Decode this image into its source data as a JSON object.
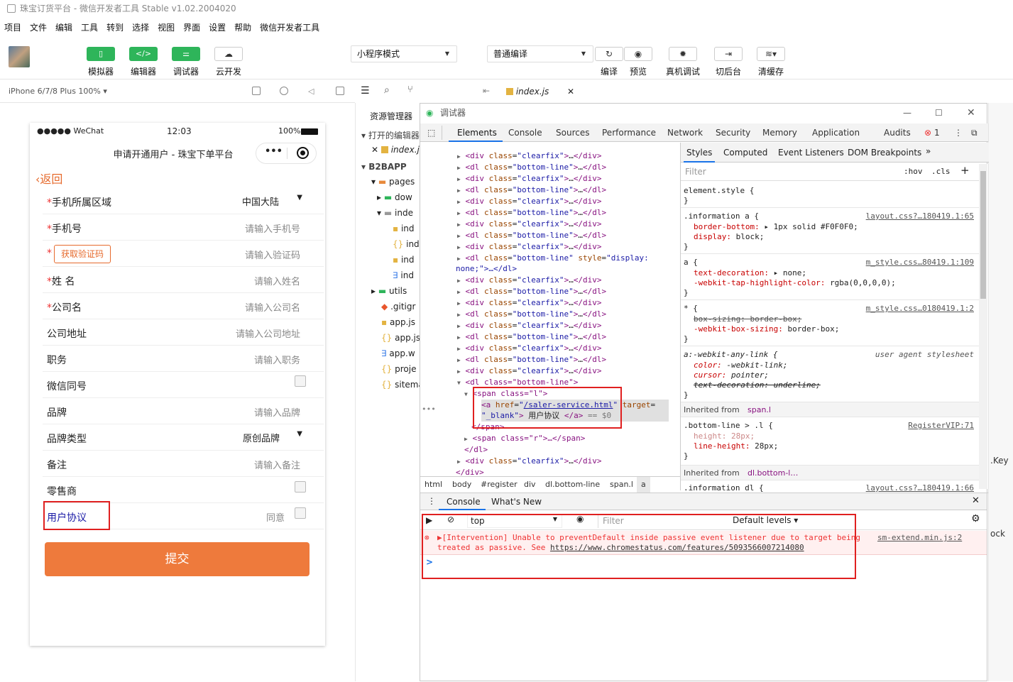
{
  "window": {
    "title": "珠宝订货平台 - 微信开发者工具 Stable v1.02.2004020"
  },
  "menu": [
    "项目",
    "文件",
    "编辑",
    "工具",
    "转到",
    "选择",
    "视图",
    "界面",
    "设置",
    "帮助",
    "微信开发者工具"
  ],
  "toolbar": {
    "simulator": "模拟器",
    "editor": "编辑器",
    "debugger": "调试器",
    "cloud": "云开发",
    "mode": "小程序模式",
    "compile_mode": "普通编译",
    "compile": "编译",
    "preview": "预览",
    "real_debug": "真机调试",
    "background": "切后台",
    "clear_cache": "清缓存"
  },
  "simulator": {
    "device": "iPhone 6/7/8 Plus 100% ▾"
  },
  "phone": {
    "carrier": "●●●●● WeChat",
    "time": "12:03",
    "battery": "100%",
    "nav_title": "申请开通用户 - 珠宝下单平台",
    "back": "返回",
    "rows": [
      {
        "star": "*",
        "label": "手机所属区域",
        "value": "中国大陆"
      },
      {
        "star": "*",
        "label": "手机号",
        "placeholder": "请输入手机号"
      },
      {
        "star": "*",
        "button": "获取验证码",
        "placeholder": "请输入验证码"
      },
      {
        "star": "*",
        "label": "姓 名",
        "placeholder": "请输入姓名"
      },
      {
        "star": "*",
        "label": "公司名",
        "placeholder": "请输入公司名"
      },
      {
        "label": "公司地址",
        "placeholder": "请输入公司地址"
      },
      {
        "label": "职务",
        "placeholder": "请输入职务"
      },
      {
        "label": "微信同号"
      },
      {
        "label": "品牌",
        "placeholder": "请输入品牌"
      },
      {
        "label": "品牌类型",
        "value": "原创品牌"
      },
      {
        "label": "备注",
        "placeholder": "请输入备注"
      },
      {
        "label": "零售商"
      },
      {
        "label": "用户协议",
        "agree": "同意"
      }
    ],
    "submit": "提交"
  },
  "filetree": {
    "resource_manager": "资源管理器",
    "open_editors": "打开的编辑器",
    "open_file": "index.j",
    "project": "B2BAPP",
    "items": [
      "pages",
      "dow",
      "inde",
      "ind",
      "ind",
      "ind",
      "ind",
      "utils",
      ".gitigr",
      "app.js",
      "app.js",
      "app.w",
      "proje",
      "sitema"
    ]
  },
  "editor_tab": {
    "name": "index.js"
  },
  "devtools": {
    "title": "调试器",
    "tabs": [
      "Elements",
      "Console",
      "Sources",
      "Performance",
      "Network",
      "Security",
      "Memory",
      "Application",
      "Audits"
    ],
    "error_count": "1",
    "elements": [
      {
        "t": "div",
        "c": "clearfix"
      },
      {
        "t": "dl",
        "c": "bottom-line"
      },
      {
        "t": "div",
        "c": "clearfix"
      },
      {
        "t": "dl",
        "c": "bottom-line"
      },
      {
        "t": "div",
        "c": "clearfix"
      },
      {
        "t": "dl",
        "c": "bottom-line"
      },
      {
        "t": "div",
        "c": "clearfix"
      },
      {
        "t": "dl",
        "c": "bottom-line"
      },
      {
        "t": "div",
        "c": "clearfix"
      }
    ],
    "elements_tail": [
      {
        "t": "div",
        "c": "clearfix"
      },
      {
        "t": "dl",
        "c": "bottom-line"
      },
      {
        "t": "div",
        "c": "clearfix"
      },
      {
        "t": "dl",
        "c": "bottom-line"
      },
      {
        "t": "div",
        "c": "clearfix"
      },
      {
        "t": "dl",
        "c": "bottom-line"
      },
      {
        "t": "div",
        "c": "clearfix"
      },
      {
        "t": "dl",
        "c": "bottom-line"
      },
      {
        "t": "div",
        "c": "clearfix"
      }
    ],
    "style_none": "none;\">…</dl>",
    "open_dl": "<dl class=\"bottom-line\">",
    "span_open": "<span class=\"l\">",
    "a_href": "/saler-service.html",
    "a_target": "_blank",
    "a_text": "用户协议",
    "a_end": "== $0",
    "span_close": "</span>",
    "span_r": "<span class=\"r\">…</span>",
    "dl_close": "</dl>",
    "div_close": "</div>",
    "styles_tabs": [
      "Styles",
      "Computed",
      "Event Listeners",
      "DOM Breakpoints"
    ],
    "filter": "Filter",
    "hov": ":hov",
    "cls": ".cls",
    "breadcrumb": [
      "html",
      "body",
      "#register",
      "div",
      "dl.bottom-line",
      "span.l",
      "a"
    ],
    "style_rules": {
      "element_style": "element.style {",
      "info_a_sel": ".information a {",
      "info_a_src": "layout.css?…180419.1:65",
      "info_a_p1": "border-bottom:",
      "info_a_v1": "1px solid  #F0F0F0;",
      "info_a_p2": "display:",
      "info_a_v2": "block;",
      "a_sel": "a {",
      "a_src": "m_style.css…80419.1:109",
      "a_p1": "text-decoration:",
      "a_v1": "none;",
      "a_p2": "-webkit-tap-highlight-color:",
      "a_v2": "rgba(0,0,0,0);",
      "star_sel": "* {",
      "star_src": "m_style.css…0180419.1:2",
      "star_p1": "box-sizing: border-box;",
      "star_p2": "-webkit-box-sizing:",
      "star_v2": "border-box;",
      "ua_sel": "a:-webkit-any-link {",
      "ua_src": "user agent stylesheet",
      "ua_p1": "color:",
      "ua_v1": "-webkit-link;",
      "ua_p2": "cursor:",
      "ua_v2": "pointer;",
      "ua_p3": "text-decoration: underline;",
      "inh1": "Inherited from",
      "inh1_v": "span.l",
      "bl_sel": ".bottom-line > .l {",
      "bl_src": "RegisterVIP:71",
      "bl_p1": "height: 28px;",
      "bl_p2": "line-height:",
      "bl_v2": "28px;",
      "inh2": "Inherited from",
      "inh2_v": "dl.bottom-l…",
      "last_sel": ".information dl {",
      "last_src": "layout.css?…180419.1:66"
    },
    "console": {
      "tabs": [
        "Console",
        "What's New"
      ],
      "context": "top",
      "filter": "Filter",
      "levels": "Default levels ▾",
      "message": "▶[Intervention] Unable to preventDefault inside passive event listener due to target being treated as passive. See",
      "message_link": "https://www.chromestatus.com/features/5093566007214080",
      "message_src": "sm-extend.min.js:2",
      "prompt": ">"
    }
  },
  "right_edge": {
    "key": ".Key",
    "ock": "ock"
  },
  "colors": {
    "green": "#2eb55a",
    "submit": "#ee7a3c",
    "highlight": "#e02020",
    "link": "#1a1aa6"
  }
}
